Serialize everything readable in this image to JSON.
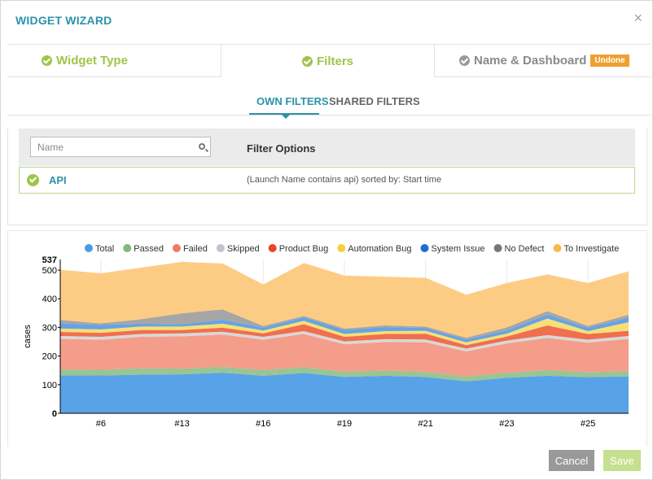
{
  "header": {
    "title": "WIDGET WIZARD",
    "close_label": "×"
  },
  "wizard_tabs": [
    {
      "label": "Widget Type",
      "state": "done"
    },
    {
      "label": "Filters",
      "state": "done"
    },
    {
      "label": "Name & Dashboard",
      "state": "pending",
      "badge": "Undone"
    }
  ],
  "filter_tabs": {
    "own": "OWN FILTERS",
    "shared": "SHARED FILTERS"
  },
  "filter_table": {
    "search_placeholder": "Name",
    "options_header": "Filter Options",
    "rows": [
      {
        "name": "API",
        "description": "(Launch Name contains api) sorted by: Start time"
      }
    ]
  },
  "footer": {
    "cancel": "Cancel",
    "save": "Save"
  },
  "colors": {
    "accent": "#2b93a8",
    "done_green": "#9ec54a",
    "badge_orange": "#f0a030"
  },
  "chart_data": {
    "type": "area",
    "stacked": true,
    "ylabel": "cases",
    "ylim": [
      0,
      537
    ],
    "yticks": [
      0,
      100,
      200,
      300,
      400,
      500
    ],
    "ymax_label": "537",
    "x_tick_labels": [
      "#6",
      "#13",
      "#16",
      "#19",
      "#21",
      "#23",
      "#25"
    ],
    "x_tick_positions": [
      1,
      3,
      5,
      7,
      9,
      11,
      13
    ],
    "x_count": 15,
    "legend": [
      {
        "name": "Total",
        "color": "#4a9be6"
      },
      {
        "name": "Passed",
        "color": "#7fba7a"
      },
      {
        "name": "Failed",
        "color": "#f07a63"
      },
      {
        "name": "Skipped",
        "color": "#bfc4cc"
      },
      {
        "name": "Product Bug",
        "color": "#e8452c"
      },
      {
        "name": "Automation Bug",
        "color": "#f2d13a"
      },
      {
        "name": "System Issue",
        "color": "#1b6fd0"
      },
      {
        "name": "No Defect",
        "color": "#777777"
      },
      {
        "name": "To Investigate",
        "color": "#fab94e"
      }
    ],
    "series": [
      {
        "name": "Passed",
        "color": "#4a9be6",
        "values": [
          133,
          132,
          135,
          136,
          142,
          131,
          141,
          127,
          131,
          127,
          112,
          124,
          131,
          126,
          129
        ]
      },
      {
        "name": "Passed",
        "color": "#8fc08a",
        "values": [
          20,
          20,
          22,
          20,
          20,
          20,
          20,
          18,
          18,
          18,
          16,
          18,
          20,
          18,
          18
        ]
      },
      {
        "name": "Failed",
        "color": "#f39580",
        "values": [
          107,
          105,
          110,
          113,
          113,
          106,
          116,
          96,
          100,
          103,
          88,
          102,
          112,
          103,
          113
        ]
      },
      {
        "name": "Skipped",
        "color": "#d5d5d5",
        "values": [
          10,
          10,
          10,
          10,
          10,
          10,
          10,
          10,
          10,
          10,
          10,
          10,
          10,
          10,
          10
        ]
      },
      {
        "name": "Product Bug",
        "color": "#ee6340",
        "values": [
          14,
          14,
          14,
          12,
          14,
          12,
          24,
          16,
          18,
          20,
          12,
          14,
          34,
          20,
          18
        ]
      },
      {
        "name": "Automation Bug",
        "color": "#f6dc6a",
        "values": [
          12,
          12,
          12,
          12,
          14,
          10,
          12,
          10,
          10,
          10,
          10,
          10,
          24,
          10,
          30
        ]
      },
      {
        "name": "System Issue",
        "color": "#5a9be0",
        "values": [
          18,
          16,
          10,
          8,
          14,
          10,
          12,
          14,
          14,
          10,
          10,
          12,
          14,
          12,
          16
        ]
      },
      {
        "name": "No Defect",
        "color": "#9e9e9e",
        "values": [
          12,
          5,
          16,
          38,
          36,
          6,
          5,
          5,
          6,
          5,
          6,
          10,
          12,
          6,
          10
        ]
      },
      {
        "name": "To Investigate",
        "color": "#fdc87a",
        "values": [
          175,
          175,
          180,
          180,
          160,
          145,
          185,
          185,
          170,
          170,
          150,
          155,
          128,
          150,
          152
        ]
      }
    ]
  }
}
